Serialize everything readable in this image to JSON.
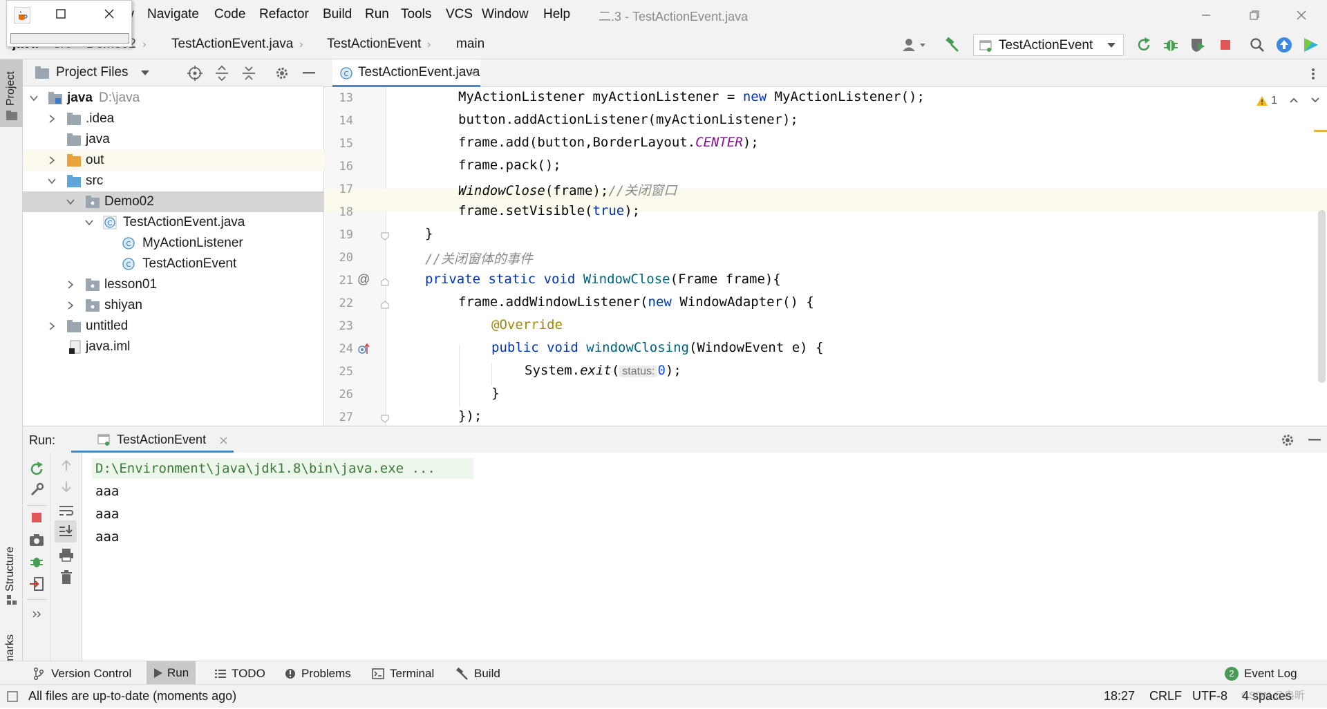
{
  "menu": {
    "items": [
      {
        "label": "Navigate"
      },
      {
        "label": "Code"
      },
      {
        "label": "Refactor"
      },
      {
        "label": "Build"
      },
      {
        "label": "Run"
      },
      {
        "label": "Tools"
      },
      {
        "label": "VCS"
      },
      {
        "label": "Window"
      },
      {
        "label": "Help"
      }
    ],
    "partial_first": "w",
    "window_title": "二.3 - TestActionEvent.java"
  },
  "breadcrumbs": {
    "root": "java",
    "src": "src",
    "pkg": "Demo02",
    "file": "TestActionEvent.java",
    "cls": "TestActionEvent",
    "method": "main"
  },
  "run_config": {
    "selected": "TestActionEvent"
  },
  "left_strip": {
    "project": "Project",
    "structure": "Structure",
    "bookmarks": "Bookmarks"
  },
  "project_panel": {
    "title": "Project Files",
    "tree": [
      {
        "label": "java",
        "extra": "D:\\java"
      },
      {
        "label": ".idea"
      },
      {
        "label": "java"
      },
      {
        "label": "out"
      },
      {
        "label": "src"
      },
      {
        "label": "Demo02"
      },
      {
        "label": "TestActionEvent.java"
      },
      {
        "label": "MyActionListener"
      },
      {
        "label": "TestActionEvent"
      },
      {
        "label": "lesson01"
      },
      {
        "label": "shiyan"
      },
      {
        "label": "untitled"
      },
      {
        "label": "java.iml"
      }
    ]
  },
  "editor": {
    "tab": "TestActionEvent.java",
    "warning_count": "1",
    "line_numbers": [
      "13",
      "14",
      "15",
      "16",
      "17",
      "18",
      "19",
      "20",
      "21",
      "22",
      "23",
      "24",
      "25",
      "26",
      "27"
    ],
    "code": {
      "l13a": "MyActionListener myActionListener = ",
      "l13kw": "new",
      "l13b": " MyActionListener();",
      "l14": "button.addActionListener(myActionListener);",
      "l15a": "frame.add(button,BorderLayout.",
      "l15c": "CENTER",
      "l15b": ");",
      "l16": "frame.pack();",
      "l17a": "WindowClose",
      "l17b": "(frame);",
      "l17c": "//关闭窗口",
      "l18a": "frame.setVisible(",
      "l18kw": "true",
      "l18b": ");",
      "l19": "}",
      "l20": "//关闭窗体的事件",
      "l21kw": "private static void ",
      "l21fn": "WindowClose",
      "l21b": "(Frame frame){",
      "l22a": "frame.addWindowListener(",
      "l22kw": "new",
      "l22b": " WindowAdapter() {",
      "l23": "@Override",
      "l24kw": "public void ",
      "l24fn": "windowClosing",
      "l24b": "(WindowEvent e) {",
      "l25a": "System.",
      "l25it": "exit",
      "l25b": "(",
      "l25hint": "status:",
      "l25num": "0",
      "l25c": ");",
      "l26": "}",
      "l27": "});"
    },
    "gutter_at": "@"
  },
  "run_panel": {
    "label": "Run:",
    "tab": "TestActionEvent",
    "output": [
      "D:\\Environment\\java\\jdk1.8\\bin\\java.exe ...",
      "aaa",
      "aaa",
      "aaa"
    ]
  },
  "tool_windows": {
    "version_control": "Version Control",
    "run": "Run",
    "todo": "TODO",
    "problems": "Problems",
    "terminal": "Terminal",
    "build": "Build",
    "event_log": "Event Log",
    "event_log_count": "2"
  },
  "status": {
    "message": "All files are up-to-date (moments ago)",
    "position": "18:27",
    "line_sep": "CRLF",
    "encoding": "UTF-8",
    "indent": "4 spaces",
    "watermark": "CSDN @冉昕"
  },
  "colors": {
    "accent": "#4a88c7",
    "highlight_line": "#fcfaed",
    "folder_orange": "#e8a33d",
    "stop_red": "#e05555",
    "run_green": "#499c54"
  }
}
